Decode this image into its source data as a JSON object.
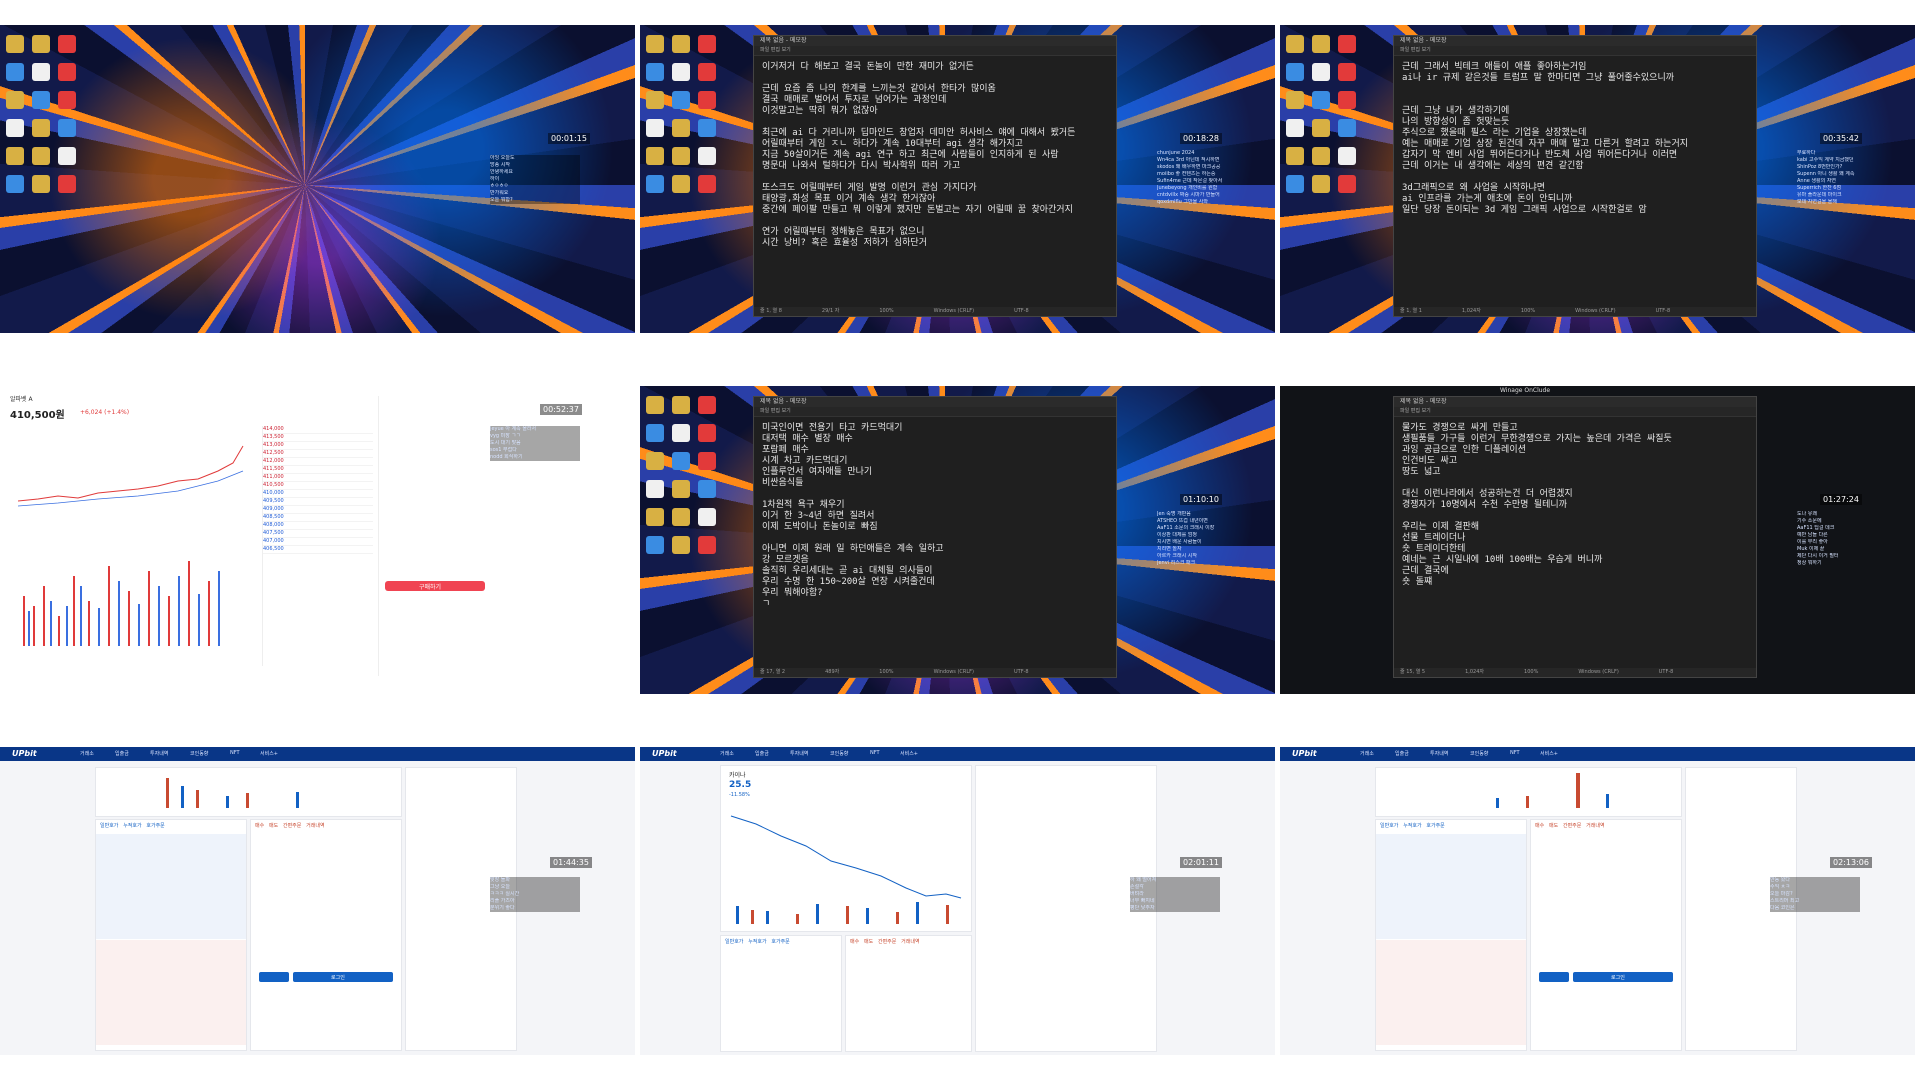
{
  "tiles": [
    {
      "timer": "00:01:15",
      "chat": [
        "아잉 오늘도",
        "방송 시작",
        "안녕하세요",
        "하이",
        "ㅎㅇㅎㅇ",
        "반가워요",
        "오늘 뭐함?"
      ]
    },
    {
      "timer": "00:18:28",
      "notepad": [
        "이거저거 다 해보고 결국 돈놀이 만한 재미가 없거든",
        "",
        "근데 요즘 좀 나의 한계를 느끼는것 같아서 한타가 많이옴",
        "결국 매매로 벌어서 투자로 넘어가는 과정인데",
        "이것말고는 딱히 뭐가 없잖아",
        "",
        "최근에 ai 다 거리니까 딥마인드 창업자 데미안 허사비스 얘에 대해서 봤거든",
        "어릴때부터 게임 ㅈㄴ 하다가 계속 10대부터 agi 생각 해가지고",
        "지금 50살이거든 계속 agi 연구 하고 최근에 사람들이 인지하게 된 사람",
        "명문대 나와서 털하다가 다시 박사학위 따러 가고",
        "",
        "또스크도 어릴때부터 게임 발명 이런거 관심 가지다가",
        "태양광,화성 목표 이거 계속 생각 한거잖아",
        "중간에 페이팔 만들고 뭐 이렇게 했지만 돈벌고는 자기 어릴때 꿈 찾아간거지",
        "",
        "연가 어릴때부터 정해놓은 목표가 없으니",
        "시간 낭비? 혹은 효율성 저하가 심하단거"
      ],
      "chat": [
        "chunjune 2024",
        "Wn4ca 3rd 아닌데 적시하면",
        "skodos 왜 배우하면 마크공공",
        "moiibo 좋 컨텐츠는 하는중",
        "Sufin4me 근데 작은걸 찾아서",
        "Junebeyong 개인비를 원함",
        "cntdvillx 짜증 시마가 만들어",
        "qoxdmlflu 그만을 사와"
      ],
      "status": [
        "줄 1, 열 8",
        "29/1 자",
        "100%",
        "Windows (CRLF)",
        "UTF-8"
      ]
    },
    {
      "timer": "00:35:42",
      "notepad": [
        "근데 그래서 빅테크 애들이 애플 좋아하는거임",
        "ai나 ir 규제 같은것들 트럼프 말 한마디면 그냥 풀어줄수있으니까",
        "",
        "",
        "근데 그냥 내가 생각하기에",
        "나의 방향성이 좀 헛맞는듯",
        "주식으로 했을때 필스 라는 기업을 상장했는데",
        "예는 매매로 기업 상장 된건데 자꾸 매매 말고 다른거 할려고 하는거지",
        "갑자기 막 엔비 사업 뛰어든다거나 반도체 사업 뛰어든다거나 이러면",
        "근데 이거는 내 생각에는 세상의 편견 같긴함",
        "",
        "3d그래픽으로 왜 사업을 시작하냐면",
        "ai 인프라를 가는게 애초에 돈이 안되니까",
        "일단 당장 돈이되는 3d 게임 그래픽 사업으로 시작한걸로 암"
      ],
      "chat": [
        "무료하다",
        "kabi 고수익 계약 지금했던",
        "ShinPoz 8번만인가?",
        "Supenn 아니 생활 왜 계속",
        "Anne 생활의 자연",
        "Superrich 한잔 6점",
        "유마 플라운데 마이크",
        "모데 자연걸을 올해"
      ],
      "status": [
        "줄 1, 열 1",
        "1,024자",
        "100%",
        "Windows (CRLF)",
        "UTF-8"
      ]
    },
    {
      "timer": "00:52:37",
      "stock_name": "알파벳 A",
      "price": "410,500원",
      "change": "+6,024 (+1.4%)",
      "buy_button": "구매하기",
      "order_rows": [
        "414,000",
        "413,500",
        "413,000",
        "412,500",
        "412,000",
        "411,500",
        "411,000",
        "410,500",
        "410,000",
        "409,500",
        "409,000",
        "408,500",
        "408,000",
        "407,500",
        "407,000",
        "406,500"
      ],
      "chat": [
        "Jeyue 아 계속 올라서",
        "vyg 미장 ㄱㄱ",
        "도시 대기 맞음",
        "sos1 부럽다",
        "nodd 회식하기"
      ]
    },
    {
      "timer": "01:10:10",
      "notepad": [
        "미국인이면 전용기 타고 카드먹대기",
        "대저택 매수 별장 매수",
        "포람페 매수",
        "시계 차고 카드먹대기",
        "인플루언서 여자애들 만나기",
        "비싼음식들",
        "",
        "1차원적 욕구 채우기",
        "이거 한 3~4년 하면 질려서",
        "이제 도박이나 돈놀이로 빠짐",
        "",
        "아니면 이제 원래 일 하던애들은 계속 일하고",
        "강 모르겟음",
        "솔직히 우리세대는 곧 ai 대체될 의사들이",
        "우리 수명 한 150~200살 연장 시켜줄건데",
        "우리 뭐해야함?",
        "ㄱ"
      ],
      "chat": [
        "Jen 숙명 개판음",
        "ATSHEO 뜨겁 내년이면",
        "AaF11 소문의 크래시 이장",
        "이상판 대체를 엄청",
        "치시면 배운 사람들이",
        "치리면 놀자",
        "아르카 크래시 시작",
        "Jenvi 리스크 패크"
      ],
      "status": [
        "줄 17, 열 2",
        "489자",
        "100%",
        "Windows (CRLF)",
        "UTF-8"
      ]
    },
    {
      "timer": "01:27:24",
      "window_title": "Winage OnClude",
      "notepad": [
        "물가도 경쟁으로 싸게 만들고",
        "생필품들 가구들 이런거 무한경쟁으로 가지는 높은데 가격은 싸질듯",
        "과잉 공급으로 인한 디플레이션",
        "인건비도 싸고",
        "땅도 넓고",
        "",
        "대신 이런나라에서 성공하는건 더 어렵겠지",
        "경쟁자가 10명에서 수천 수만명 될테니까",
        "",
        "우리는 이제 결판해",
        "선물 트레이더나",
        "숏 트레이더한테",
        "예네는 근 시일내에 10배 100배는 우습게 버니까",
        "근데 결국에",
        "숏 돌쨰"
      ],
      "chat": [
        "도나 유쾌",
        "기수 소문에",
        "AaF11 딥걸 데크",
        "예반 남들 다른",
        "이를 무리 좋아",
        "Muk 이제 끝",
        "제단 다시 이거 필터",
        "정상 뭐하기"
      ],
      "status": [
        "줄 15, 열 5",
        "1,024자",
        "100%",
        "Windows (CRLF)",
        "UTF-8"
      ]
    },
    {
      "timer": "01:44:35",
      "brand": "UPbit",
      "nav": [
        "거래소",
        "입출금",
        "투자내역",
        "코인동향",
        "NFT",
        "서비스+"
      ],
      "tabs": [
        "일반호가",
        "누적호가",
        "호가주문"
      ],
      "order_tabs": [
        "매수",
        "매도",
        "간편주문",
        "거래내역"
      ],
      "buy_label": "매수",
      "sell_label": "로그인",
      "chat": [
        "맞장 돌파",
        "그냥 오늘",
        "ㅋㅋㅋ 실시간",
        "리플 가즈아",
        "분위기 좋다"
      ]
    },
    {
      "timer": "02:01:11",
      "brand": "UPbit",
      "coin": "카이나",
      "coin_price": "25.5",
      "coin_change": "-11.58%",
      "nav": [
        "거래소",
        "입출금",
        "투자내역",
        "코인동향",
        "NFT",
        "서비스+"
      ],
      "tabs": [
        "일반호가",
        "누적호가",
        "호가주문"
      ],
      "order_tabs": [
        "매수",
        "매도",
        "간편주문",
        "거래내역"
      ],
      "chat": [
        "하 왜 떨어져",
        "손절각",
        "버텨라",
        "너무 빠지네",
        "평단 낮추자"
      ]
    },
    {
      "timer": "02:13:06",
      "brand": "UPbit",
      "nav": [
        "거래소",
        "입출금",
        "투자내역",
        "코인동향",
        "NFT",
        "서비스+"
      ],
      "tabs": [
        "일반호가",
        "누적호가",
        "호가주문"
      ],
      "order_tabs": [
        "매수",
        "매도",
        "간편주문",
        "거래내역"
      ],
      "buy_label": "매수",
      "sell_label": "로그인",
      "chat": [
        "반등 왔다",
        "수익 ㅊㅋ",
        "오늘 마감?",
        "스트리머 최고",
        "다음 코인은"
      ]
    }
  ]
}
